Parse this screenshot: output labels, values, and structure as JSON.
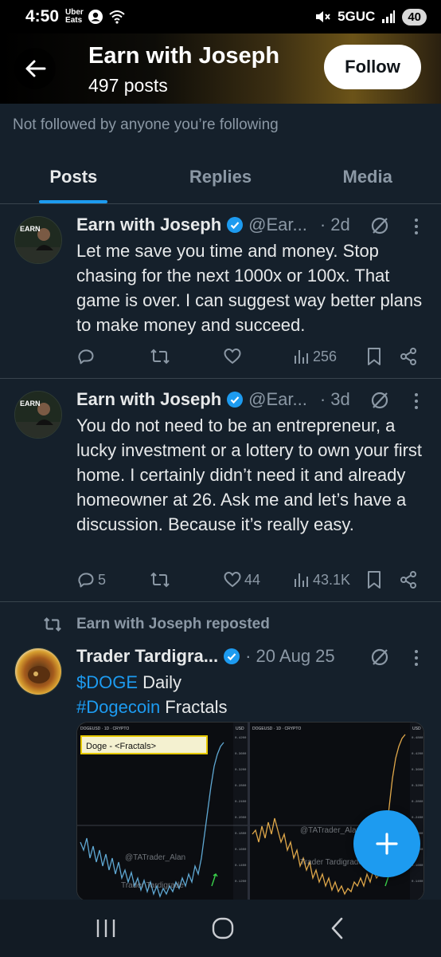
{
  "status_bar": {
    "time": "4:50",
    "app_notification": "Uber Eats",
    "network": "5GUC",
    "battery": "40"
  },
  "header": {
    "title": "Earn with Joseph",
    "post_count": "497 posts",
    "follow_label": "Follow"
  },
  "not_followed_text": "Not followed by anyone you’re following",
  "tabs": [
    {
      "label": "Posts",
      "active": true
    },
    {
      "label": "Replies",
      "active": false
    },
    {
      "label": "Media",
      "active": false
    }
  ],
  "tweets": [
    {
      "name": "Earn with Joseph",
      "handle": "@Ear...",
      "time": "· 2d",
      "text": "Let me save you time and money. Stop chasing for the next 1000x or 100x. That game is over. I can suggest way better plans to make money and succeed.",
      "reply_count": "",
      "like_count": "",
      "views": "256"
    },
    {
      "name": "Earn with Joseph",
      "handle": "@Ear...",
      "time": "· 3d",
      "text": "You do not need to be an entrepreneur, a lucky investment or a lottery to own your first home. I certainly didn’t need it and already homeowner at 26. Ask me and let’s have a discussion. Because it’s really easy.",
      "reply_count": "5",
      "like_count": "44",
      "views": "43.1K"
    }
  ],
  "repost": {
    "label": "Earn with Joseph reposted",
    "name": "Trader Tardigra...",
    "time": "· 20 Aug 25",
    "line1_tag": "$DOGE",
    "line1_rest": " Daily",
    "line2_tag": "#Dogecoin",
    "line2_rest": " Fractals",
    "image": {
      "left_symbol": "DOGEUSD · 1D · CRYPTO",
      "right_symbol": "DOGEUSD · 1D · CRYPTO",
      "box_label": "Doge - <Fractals>",
      "watermark1": "@TATrader_Alan",
      "watermark2": "Trader Tardigrade",
      "watermark3": "@TATrader_Alan",
      "watermark4": "Trader Tardigrade",
      "usd_left": "USD",
      "usd_right": "USD"
    }
  },
  "colors": {
    "background": "#15202b",
    "accent": "#1d9bf0",
    "secondary_text": "#8b98a5"
  }
}
